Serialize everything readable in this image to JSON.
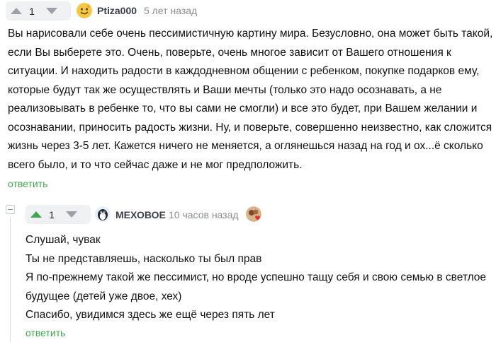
{
  "comment1": {
    "rating": "1",
    "author": "Ptiza000",
    "time": "5 лет назад",
    "avatar_icon": "smiley-avatar-icon",
    "avatar_color": "#f5c842",
    "paragraphs": [
      "Вы нарисовали себе очень пессимистичную картину мира. Безусловно, она может быть такой, если Вы выберете это. Очень, поверьте, очень многое зависит от Вашего отношения к ситуации. И находить радости в каждодневном общении с ребенком, покупке подарков ему, которые будут так же осуществлять и Ваши мечты (только это надо осознавать, а не реализовывать в ребенке то, что вы сами не смогли) и все это будет, при Вашем желании и осознавании, приносить радость жизни. Ну, и поверьте, совершенно неизвестно, как сложится жизнь через 3-5 лет. Кажется ничего не меняется, а оглянешься назад на год и ох...ё сколько всего было, и то что сейчас даже и не мог предположить."
    ],
    "reply_label": "ответить"
  },
  "comment2": {
    "rating": "1",
    "author": "МЕХОВОЕ",
    "time": "10 часов назад",
    "avatar_icon": "penguin-avatar-icon",
    "badge_icon": "heart-badge-icon",
    "paragraphs": [
      "Слушай, чувак",
      "Ты не представляешь, насколько ты был прав",
      "Я по-прежнему такой же пессимист, но вроде успешно тащу себя и свою семью в светлое будущее (детей уже двое, хех)",
      "Спасибо, увидимся здесь же ещё через пять лет"
    ],
    "reply_label": "ответить"
  },
  "colors": {
    "accent_green": "#41a84e",
    "vote_bg": "#f0f1f3",
    "muted_text": "#888d94"
  }
}
